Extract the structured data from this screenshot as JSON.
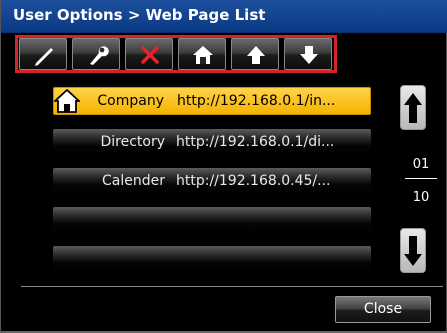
{
  "window": {
    "title": "User Options > Web Page List"
  },
  "toolbar": {
    "buttons": [
      {
        "icon": "pencil-icon",
        "action": "edit"
      },
      {
        "icon": "wrench-icon",
        "action": "settings"
      },
      {
        "icon": "delete-x-icon",
        "action": "delete"
      },
      {
        "icon": "home-icon",
        "action": "set-home"
      },
      {
        "icon": "arrow-up-icon",
        "action": "move-up"
      },
      {
        "icon": "arrow-down-icon",
        "action": "move-down"
      }
    ],
    "highlight_color": "#d1252b"
  },
  "list": {
    "items": [
      {
        "name": "Company",
        "url": "http://192.168.0.1/in...",
        "selected": true,
        "home": true
      },
      {
        "name": "Directory",
        "url": "http://192.168.0.1/di...",
        "selected": false,
        "home": false
      },
      {
        "name": "Calender",
        "url": "http://192.168.0.45/...",
        "selected": false,
        "home": false
      },
      {
        "name": "",
        "url": "",
        "selected": false,
        "home": false
      },
      {
        "name": "",
        "url": "",
        "selected": false,
        "home": false
      }
    ],
    "selected_color": "#f5b300"
  },
  "pager": {
    "current": "01",
    "total": "10"
  },
  "footer": {
    "close_label": "Close"
  },
  "colors": {
    "title_bar": "#0b3a85",
    "background": "#000000"
  }
}
